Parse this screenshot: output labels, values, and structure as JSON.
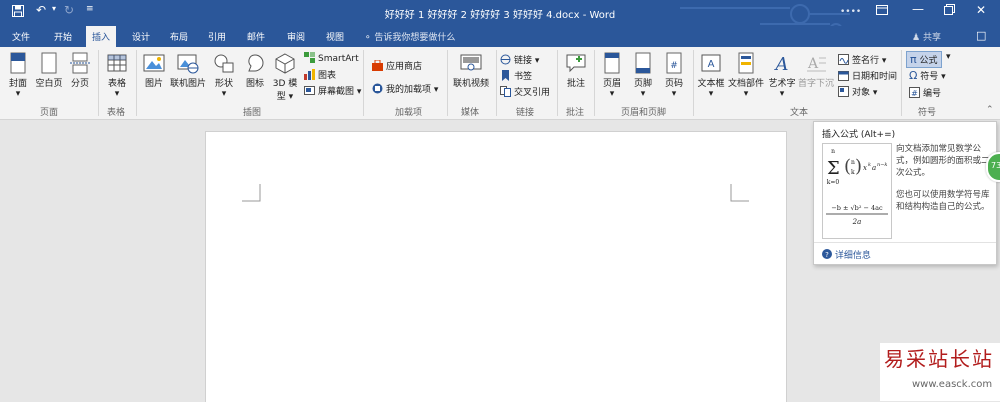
{
  "window": {
    "title": "好好好 1 好好好 2 好好好 3 好好好 4.docx - Word",
    "user": "••••"
  },
  "tabs": [
    {
      "label": "文件"
    },
    {
      "label": "开始"
    },
    {
      "label": "插入",
      "active": true
    },
    {
      "label": "设计"
    },
    {
      "label": "布局"
    },
    {
      "label": "引用"
    },
    {
      "label": "邮件"
    },
    {
      "label": "审阅"
    },
    {
      "label": "视图"
    }
  ],
  "tell_me": "告诉我你想要做什么",
  "share": "共享",
  "ribbon": {
    "pages": {
      "cover": "封面",
      "blank": "空白页",
      "break": "分页",
      "group": "页面"
    },
    "tables": {
      "table": "表格",
      "group": "表格"
    },
    "illustrations": {
      "picture": "图片",
      "online_picture": "联机图片",
      "shapes": "形状",
      "icons": "图标",
      "model_3d_line1": "3D 模",
      "model_3d_line2": "型",
      "smartart": "SmartArt",
      "chart": "图表",
      "screenshot": "屏幕截图",
      "group": "插图"
    },
    "addins": {
      "store": "应用商店",
      "my_addins": "我的加载项",
      "group": "加载项"
    },
    "media": {
      "online_video": "联机视频",
      "group": "媒体"
    },
    "links": {
      "link": "链接",
      "bookmark": "书签",
      "cross_ref": "交叉引用",
      "group": "链接"
    },
    "comments": {
      "comment": "批注",
      "group": "批注"
    },
    "header_footer": {
      "header": "页眉",
      "footer": "页脚",
      "page_number": "页码",
      "group": "页眉和页脚"
    },
    "text": {
      "textbox": "文本框",
      "quick_parts": "文档部件",
      "wordart": "艺术字",
      "dropcap": "首字下沉",
      "signature": "签名行",
      "datetime": "日期和时间",
      "object": "对象",
      "group": "文本"
    },
    "symbols": {
      "equation": "公式",
      "symbol": "符号",
      "numbering": "编号",
      "group": "符号"
    }
  },
  "tooltip": {
    "title": "插入公式 (Alt+=)",
    "description1": "向文档添加常见数学公式，例如圆形的面积或二次公式。",
    "description2": "您也可以使用数学符号库和结构构造自己的公式。",
    "more_info": "详细信息",
    "binomial": {
      "sum_top": "n",
      "sum_bottom": "k=0",
      "binom_n": "n",
      "binom_k": "k",
      "terms": "x",
      "k": "k",
      "a": "a",
      "nk": "n−k"
    },
    "quadratic": {
      "numerator": "−b ± √b² − 4ac",
      "denominator": "2a"
    }
  },
  "badge": "73",
  "watermark": {
    "text": "易采站长站",
    "url": "www.easck.com"
  },
  "colors": {
    "accent": "#2b579a",
    "ribbon_bg": "#f3f3f3",
    "canvas_bg": "#e6e6e6",
    "badge": "#4caf50"
  }
}
